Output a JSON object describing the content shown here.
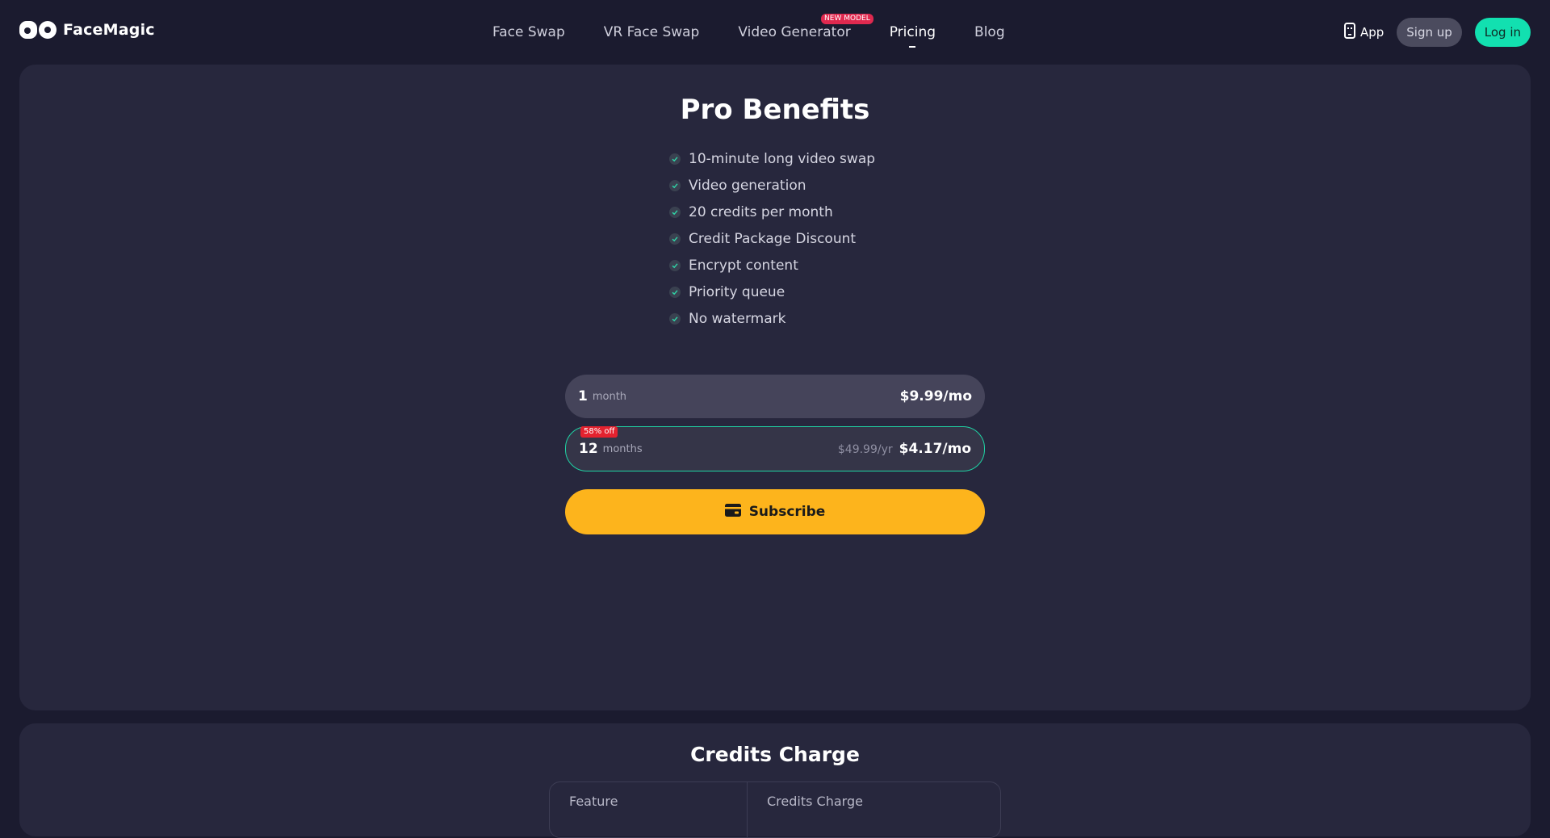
{
  "brand": {
    "name": "FaceMagic"
  },
  "nav": {
    "items": [
      {
        "label": "Face Swap"
      },
      {
        "label": "VR Face Swap"
      },
      {
        "label": "Video Generator",
        "badge": "NEW MODEL"
      },
      {
        "label": "Pricing",
        "active": true
      },
      {
        "label": "Blog"
      }
    ]
  },
  "actions": {
    "app_label": "App",
    "signup_label": "Sign up",
    "login_label": "Log in"
  },
  "pro": {
    "title": "Pro Benefits",
    "benefits": [
      "10-minute long video swap",
      "Video generation",
      "20 credits per month",
      "Credit Package Discount",
      "Encrypt content",
      "Priority queue",
      "No watermark"
    ],
    "plans": [
      {
        "qty": "1",
        "unit": "month",
        "price": "$9.99/mo",
        "selected": false
      },
      {
        "qty": "12",
        "unit": "months",
        "original": "$49.99/yr",
        "price": "$4.17/mo",
        "badge": "58% off",
        "selected": true
      }
    ],
    "subscribe_label": "Subscribe"
  },
  "credits": {
    "title": "Credits Charge",
    "columns": [
      "Feature",
      "Credits Charge"
    ]
  },
  "colors": {
    "background": "#1b1b2f",
    "panel": "#27273d",
    "accent": "#12e0b0",
    "subscribe": "#fdb41c",
    "badge_red": "#e3222f"
  },
  "icons": [
    "logo-icon",
    "phone-icon",
    "check-icon",
    "credit-card-icon"
  ]
}
